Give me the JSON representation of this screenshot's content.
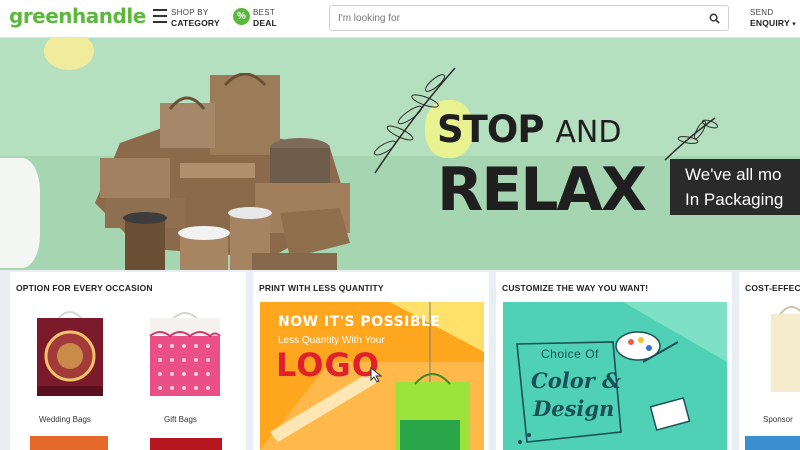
{
  "header": {
    "logo": "greenhandle",
    "shop_line1": "SHOP BY",
    "shop_line2": "CATEGORY",
    "deal_icon": "%",
    "deal_line1": "BEST",
    "deal_line2": "DEAL",
    "search_placeholder": "I'm looking for",
    "search_value": "",
    "send_line1": "SEND",
    "send_line2": "ENQUIRY",
    "send_caret": "▾"
  },
  "banner": {
    "stop": "STOP",
    "and": "AND",
    "relax": "RELAX",
    "tagline1": "We've all mo",
    "tagline2": "In Packaging"
  },
  "cards": [
    {
      "title": "OPTION FOR EVERY OCCASION",
      "items": [
        {
          "label": "Wedding Bags"
        },
        {
          "label": "Gift Bags"
        }
      ]
    },
    {
      "title": "PRINT WITH LESS QUANTITY",
      "promo_line1": "NOW IT'S POSSIBLE",
      "promo_line2": "Less Quantity With Your",
      "promo_line3": "LOGO"
    },
    {
      "title": "CUSTOMIZE THE WAY YOU WANT!",
      "promo_line1": "Choice Of",
      "promo_line2": "Color &",
      "promo_line3": "Design"
    },
    {
      "title": "COST-EFFEC",
      "items": [
        {
          "label": "Sponsor"
        }
      ]
    }
  ],
  "colors": {
    "brand_green": "#5cb83c",
    "banner_bg": "#b5e0bf",
    "promo_orange": "#ffa61f",
    "promo_teal": "#4ed1b4",
    "logo_red": "#e0202a"
  }
}
